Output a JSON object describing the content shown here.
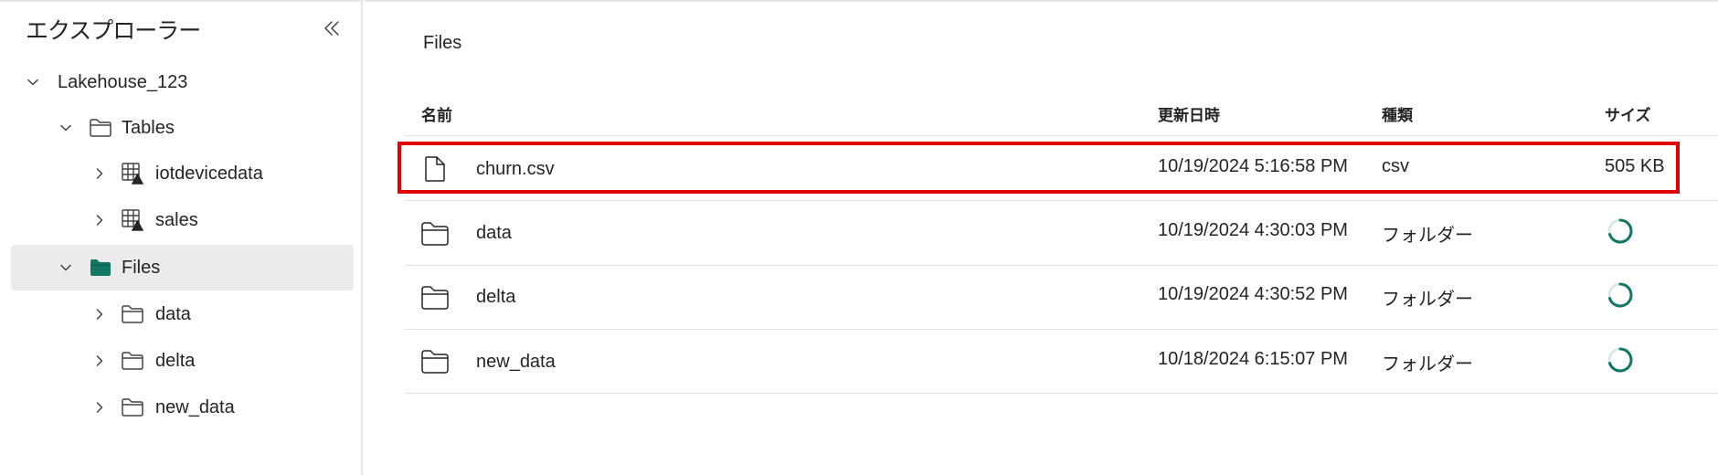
{
  "sidebar": {
    "title": "エクスプローラー",
    "collapse_icon": "double-chevron-left-icon",
    "tree": [
      {
        "label": "Lakehouse_123",
        "level": 0,
        "expanded": true,
        "icon": null
      },
      {
        "label": "Tables",
        "level": 1,
        "expanded": true,
        "icon": "folder-icon"
      },
      {
        "label": "iotdevicedata",
        "level": 2,
        "expanded": false,
        "icon": "table-icon"
      },
      {
        "label": "sales",
        "level": 2,
        "expanded": false,
        "icon": "table-icon"
      },
      {
        "label": "Files",
        "level": 1,
        "expanded": true,
        "icon": "folder-filled-icon",
        "selected": true
      },
      {
        "label": "data",
        "level": 2,
        "expanded": false,
        "icon": "folder-icon"
      },
      {
        "label": "delta",
        "level": 2,
        "expanded": false,
        "icon": "folder-icon"
      },
      {
        "label": "new_data",
        "level": 2,
        "expanded": false,
        "icon": "folder-icon"
      }
    ]
  },
  "main": {
    "breadcrumb": "Files",
    "columns": {
      "name": "名前",
      "modified": "更新日時",
      "type": "種類",
      "size": "サイズ"
    },
    "rows": [
      {
        "name": "churn.csv",
        "modified": "10/19/2024 5:16:58 PM",
        "type": "csv",
        "size": "505 KB",
        "icon": "file-icon",
        "highlighted": true
      },
      {
        "name": "data",
        "modified": "10/19/2024 4:30:03 PM",
        "type": "フォルダー",
        "size": null,
        "icon": "folder-icon",
        "size_icon": "loading-spinner-icon"
      },
      {
        "name": "delta",
        "modified": "10/19/2024 4:30:52 PM",
        "type": "フォルダー",
        "size": null,
        "icon": "folder-icon",
        "size_icon": "loading-spinner-icon"
      },
      {
        "name": "new_data",
        "modified": "10/18/2024 6:15:07 PM",
        "type": "フォルダー",
        "size": null,
        "icon": "folder-icon",
        "size_icon": "loading-spinner-icon"
      }
    ]
  },
  "colors": {
    "accent": "#117865",
    "highlight_border": "#e00000",
    "selected_bg": "#ebebeb",
    "divider": "#e1e1e1"
  }
}
